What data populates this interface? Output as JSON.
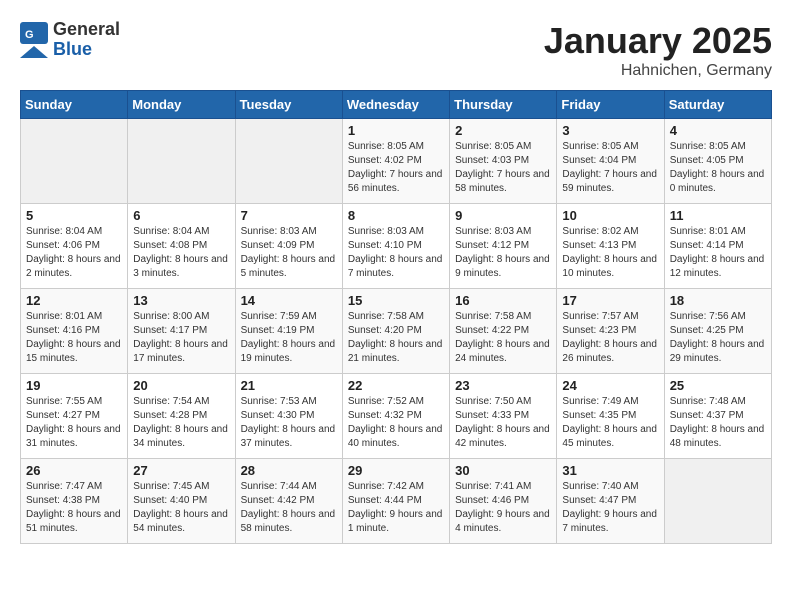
{
  "header": {
    "logo_general": "General",
    "logo_blue": "Blue",
    "month_title": "January 2025",
    "location": "Hahnichen, Germany"
  },
  "weekdays": [
    "Sunday",
    "Monday",
    "Tuesday",
    "Wednesday",
    "Thursday",
    "Friday",
    "Saturday"
  ],
  "weeks": [
    [
      {
        "day": "",
        "info": ""
      },
      {
        "day": "",
        "info": ""
      },
      {
        "day": "",
        "info": ""
      },
      {
        "day": "1",
        "info": "Sunrise: 8:05 AM\nSunset: 4:02 PM\nDaylight: 7 hours and 56 minutes."
      },
      {
        "day": "2",
        "info": "Sunrise: 8:05 AM\nSunset: 4:03 PM\nDaylight: 7 hours and 58 minutes."
      },
      {
        "day": "3",
        "info": "Sunrise: 8:05 AM\nSunset: 4:04 PM\nDaylight: 7 hours and 59 minutes."
      },
      {
        "day": "4",
        "info": "Sunrise: 8:05 AM\nSunset: 4:05 PM\nDaylight: 8 hours and 0 minutes."
      }
    ],
    [
      {
        "day": "5",
        "info": "Sunrise: 8:04 AM\nSunset: 4:06 PM\nDaylight: 8 hours and 2 minutes."
      },
      {
        "day": "6",
        "info": "Sunrise: 8:04 AM\nSunset: 4:08 PM\nDaylight: 8 hours and 3 minutes."
      },
      {
        "day": "7",
        "info": "Sunrise: 8:03 AM\nSunset: 4:09 PM\nDaylight: 8 hours and 5 minutes."
      },
      {
        "day": "8",
        "info": "Sunrise: 8:03 AM\nSunset: 4:10 PM\nDaylight: 8 hours and 7 minutes."
      },
      {
        "day": "9",
        "info": "Sunrise: 8:03 AM\nSunset: 4:12 PM\nDaylight: 8 hours and 9 minutes."
      },
      {
        "day": "10",
        "info": "Sunrise: 8:02 AM\nSunset: 4:13 PM\nDaylight: 8 hours and 10 minutes."
      },
      {
        "day": "11",
        "info": "Sunrise: 8:01 AM\nSunset: 4:14 PM\nDaylight: 8 hours and 12 minutes."
      }
    ],
    [
      {
        "day": "12",
        "info": "Sunrise: 8:01 AM\nSunset: 4:16 PM\nDaylight: 8 hours and 15 minutes."
      },
      {
        "day": "13",
        "info": "Sunrise: 8:00 AM\nSunset: 4:17 PM\nDaylight: 8 hours and 17 minutes."
      },
      {
        "day": "14",
        "info": "Sunrise: 7:59 AM\nSunset: 4:19 PM\nDaylight: 8 hours and 19 minutes."
      },
      {
        "day": "15",
        "info": "Sunrise: 7:58 AM\nSunset: 4:20 PM\nDaylight: 8 hours and 21 minutes."
      },
      {
        "day": "16",
        "info": "Sunrise: 7:58 AM\nSunset: 4:22 PM\nDaylight: 8 hours and 24 minutes."
      },
      {
        "day": "17",
        "info": "Sunrise: 7:57 AM\nSunset: 4:23 PM\nDaylight: 8 hours and 26 minutes."
      },
      {
        "day": "18",
        "info": "Sunrise: 7:56 AM\nSunset: 4:25 PM\nDaylight: 8 hours and 29 minutes."
      }
    ],
    [
      {
        "day": "19",
        "info": "Sunrise: 7:55 AM\nSunset: 4:27 PM\nDaylight: 8 hours and 31 minutes."
      },
      {
        "day": "20",
        "info": "Sunrise: 7:54 AM\nSunset: 4:28 PM\nDaylight: 8 hours and 34 minutes."
      },
      {
        "day": "21",
        "info": "Sunrise: 7:53 AM\nSunset: 4:30 PM\nDaylight: 8 hours and 37 minutes."
      },
      {
        "day": "22",
        "info": "Sunrise: 7:52 AM\nSunset: 4:32 PM\nDaylight: 8 hours and 40 minutes."
      },
      {
        "day": "23",
        "info": "Sunrise: 7:50 AM\nSunset: 4:33 PM\nDaylight: 8 hours and 42 minutes."
      },
      {
        "day": "24",
        "info": "Sunrise: 7:49 AM\nSunset: 4:35 PM\nDaylight: 8 hours and 45 minutes."
      },
      {
        "day": "25",
        "info": "Sunrise: 7:48 AM\nSunset: 4:37 PM\nDaylight: 8 hours and 48 minutes."
      }
    ],
    [
      {
        "day": "26",
        "info": "Sunrise: 7:47 AM\nSunset: 4:38 PM\nDaylight: 8 hours and 51 minutes."
      },
      {
        "day": "27",
        "info": "Sunrise: 7:45 AM\nSunset: 4:40 PM\nDaylight: 8 hours and 54 minutes."
      },
      {
        "day": "28",
        "info": "Sunrise: 7:44 AM\nSunset: 4:42 PM\nDaylight: 8 hours and 58 minutes."
      },
      {
        "day": "29",
        "info": "Sunrise: 7:42 AM\nSunset: 4:44 PM\nDaylight: 9 hours and 1 minute."
      },
      {
        "day": "30",
        "info": "Sunrise: 7:41 AM\nSunset: 4:46 PM\nDaylight: 9 hours and 4 minutes."
      },
      {
        "day": "31",
        "info": "Sunrise: 7:40 AM\nSunset: 4:47 PM\nDaylight: 9 hours and 7 minutes."
      },
      {
        "day": "",
        "info": ""
      }
    ]
  ]
}
